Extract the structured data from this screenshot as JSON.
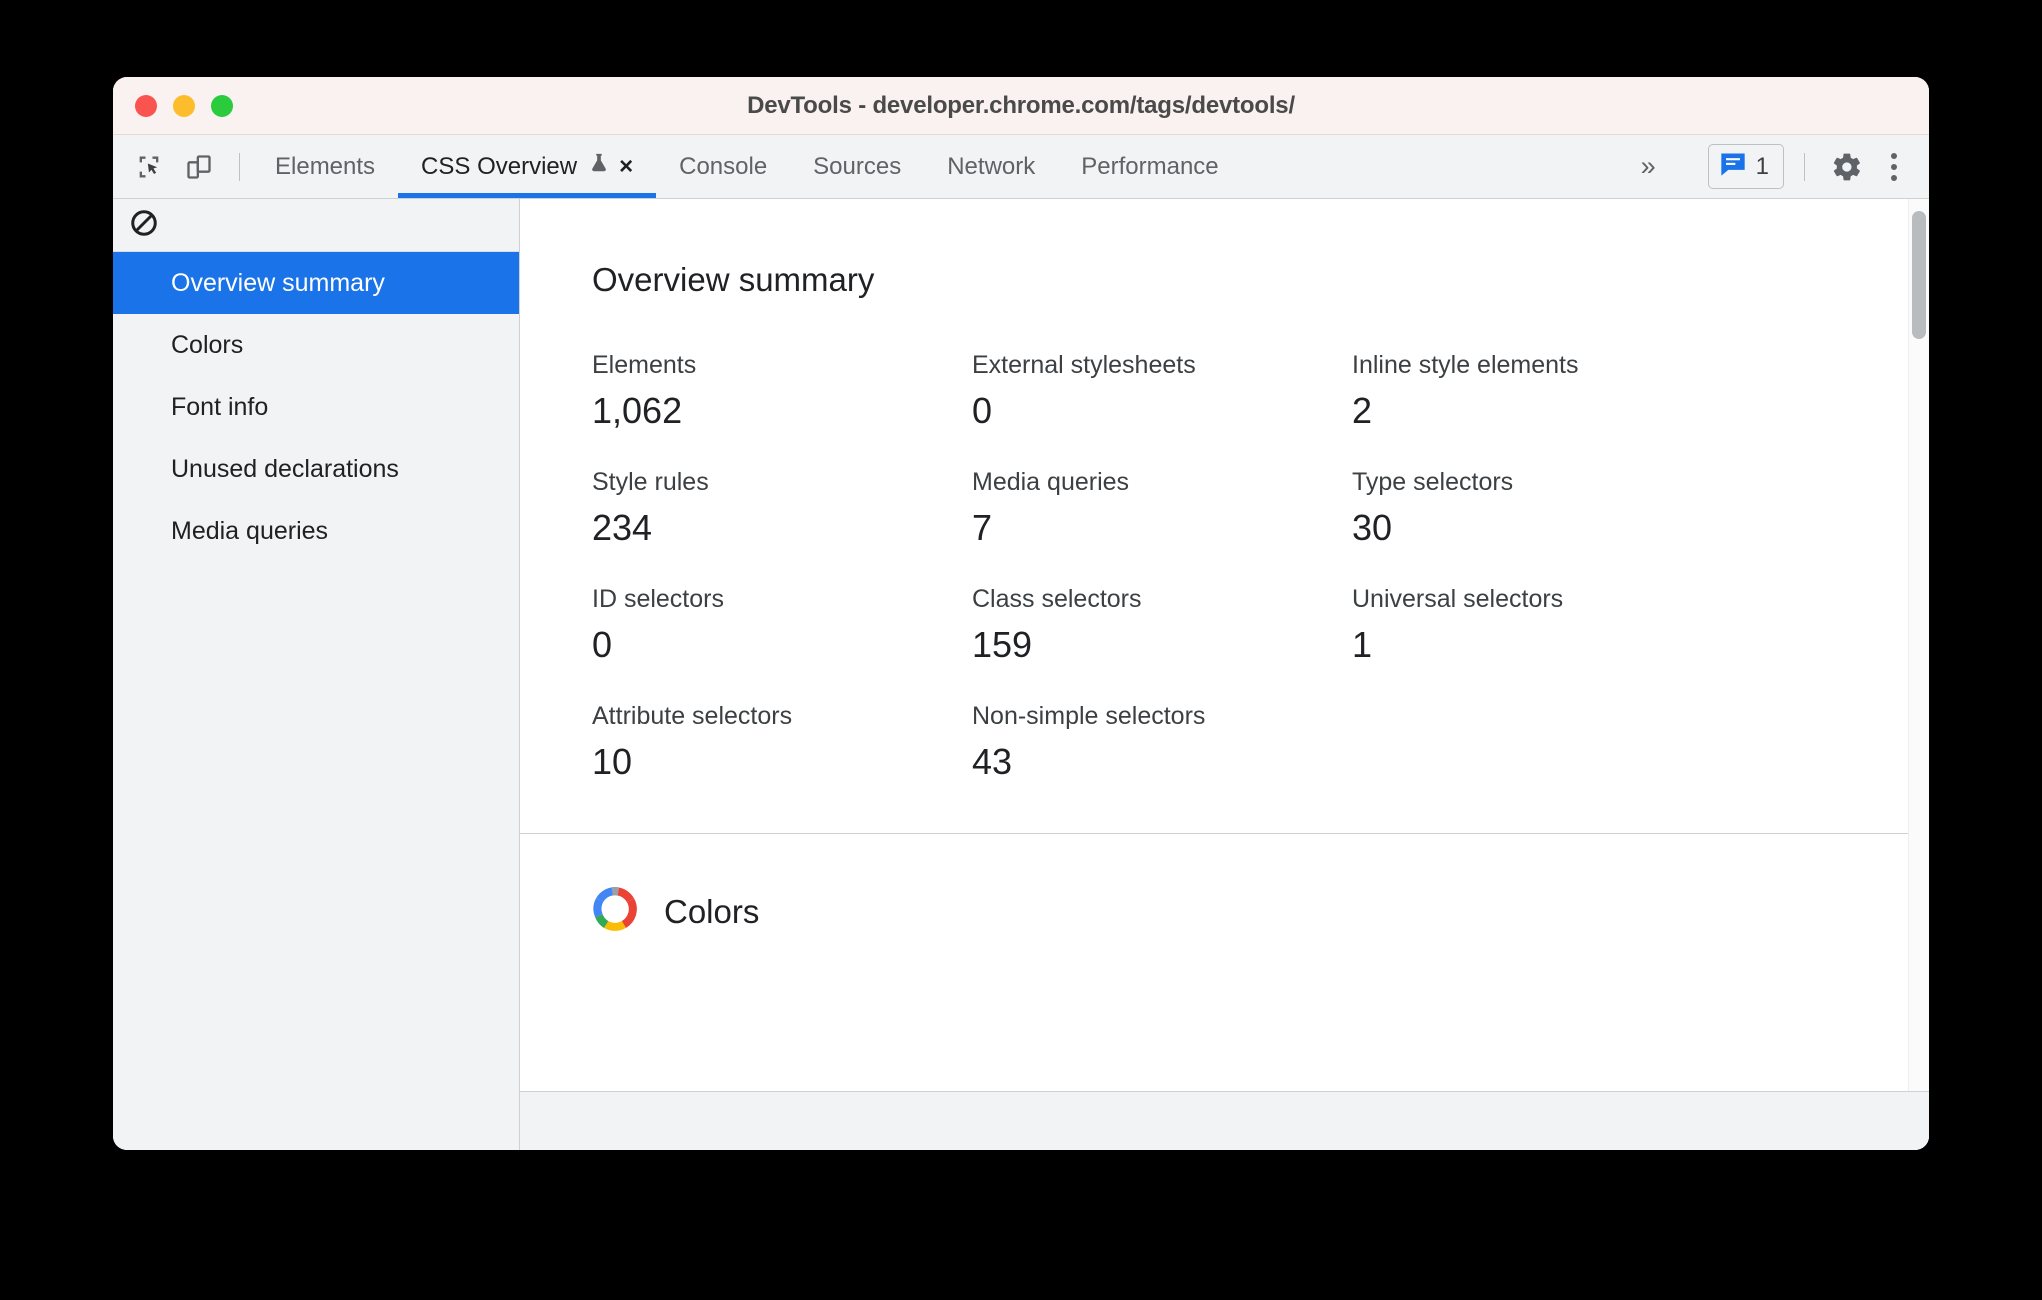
{
  "window": {
    "title": "DevTools - developer.chrome.com/tags/devtools/",
    "traffic_lights": [
      {
        "name": "close",
        "color": "#f9544f"
      },
      {
        "name": "minimize",
        "color": "#fcbc2c"
      },
      {
        "name": "zoom",
        "color": "#2bcb3e"
      }
    ]
  },
  "toolbar": {
    "inspect_icon": "inspect-cursor-icon",
    "device_toggle_icon": "device-toolbar-icon",
    "tabs": [
      {
        "label": "Elements",
        "active": false,
        "closable": false,
        "experiment": false
      },
      {
        "label": "CSS Overview",
        "active": true,
        "closable": true,
        "experiment": true
      },
      {
        "label": "Console",
        "active": false,
        "closable": false,
        "experiment": false
      },
      {
        "label": "Sources",
        "active": false,
        "closable": false,
        "experiment": false
      },
      {
        "label": "Network",
        "active": false,
        "closable": false,
        "experiment": false
      },
      {
        "label": "Performance",
        "active": false,
        "closable": false,
        "experiment": false
      }
    ],
    "close_glyph": "×",
    "overflow_glyph": "»",
    "message_count": "1",
    "message_icon": "console-message-icon",
    "settings_icon": "gear-icon",
    "more_icon": "kebab-menu-icon",
    "active_tab_accent": "#1a73e8"
  },
  "sidebar": {
    "clear_icon": "no-entry-clear-icon",
    "items": [
      {
        "label": "Overview summary",
        "selected": true
      },
      {
        "label": "Colors",
        "selected": false
      },
      {
        "label": "Font info",
        "selected": false
      },
      {
        "label": "Unused declarations",
        "selected": false
      },
      {
        "label": "Media queries",
        "selected": false
      }
    ],
    "selected_color": "#1a73e8"
  },
  "main": {
    "summary": {
      "title": "Overview summary",
      "stats": [
        {
          "label": "Elements",
          "value": "1,062"
        },
        {
          "label": "External stylesheets",
          "value": "0"
        },
        {
          "label": "Inline style elements",
          "value": "2"
        },
        {
          "label": "Style rules",
          "value": "234"
        },
        {
          "label": "Media queries",
          "value": "7"
        },
        {
          "label": "Type selectors",
          "value": "30"
        },
        {
          "label": "ID selectors",
          "value": "0"
        },
        {
          "label": "Class selectors",
          "value": "159"
        },
        {
          "label": "Universal selectors",
          "value": "1"
        },
        {
          "label": "Attribute selectors",
          "value": "10"
        },
        {
          "label": "Non-simple selectors",
          "value": "43"
        }
      ]
    },
    "colors_section": {
      "title": "Colors",
      "icon": "color-wheel-icon"
    }
  }
}
